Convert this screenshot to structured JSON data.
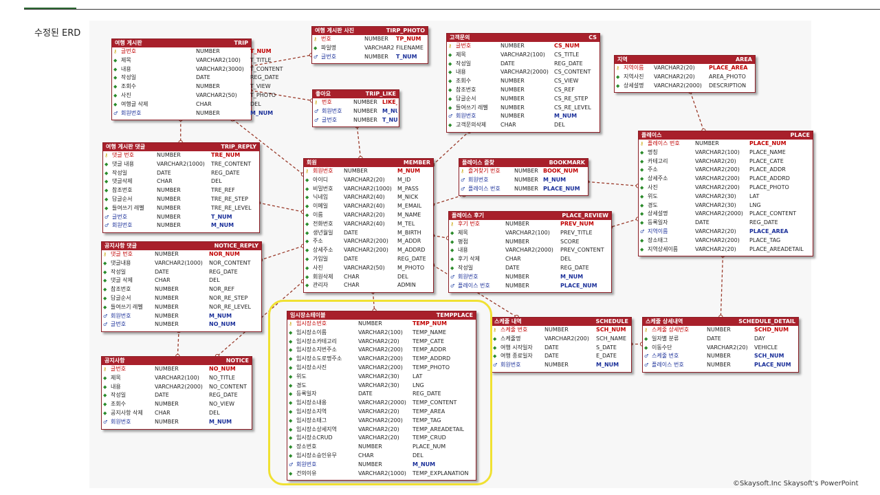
{
  "slide": {
    "title": "수정된 ERD",
    "watermark": "©Skaysoft.Inc Skaysoft's PowerPoint"
  },
  "colors": {
    "header": "#a8202b",
    "pk": "#c00000",
    "fk": "#1a2f99",
    "highlight": "#f0e132"
  },
  "entities": [
    {
      "id": "trip",
      "title": "여행 게시판",
      "table": "TRIP",
      "cols": [
        122,
        201
      ],
      "attributes": [
        {
          "name": "글번호",
          "type": "NUMBER",
          "column": "T_NUM",
          "key": "pk"
        },
        {
          "name": "제목",
          "type": "VARCHAR2(100)",
          "column": "T_TITLE",
          "key": "none"
        },
        {
          "name": "내용",
          "type": "VARCHAR2(3000)",
          "column": "T_CONTENT",
          "key": "none"
        },
        {
          "name": "작성일",
          "type": "DATE",
          "column": "REG_DATE",
          "key": "none"
        },
        {
          "name": "조회수",
          "type": "NUMBER",
          "column": "T_VIEW",
          "key": "none"
        },
        {
          "name": "사진",
          "type": "VARCHAR2(50)",
          "column": "T_PHOTO",
          "key": "none"
        },
        {
          "name": "여행글 삭제",
          "type": "CHAR",
          "column": "DEL",
          "key": "none"
        },
        {
          "name": "회원번호",
          "type": "NUMBER",
          "column": "M_NUM",
          "key": "fk"
        }
      ]
    },
    {
      "id": "trip_photo",
      "title": "여행 게시판 사진",
      "table": "TIRP_PHOTO",
      "cols": [
        76,
        122
      ],
      "attributes": [
        {
          "name": "번호",
          "type": "NUMBER",
          "column": "TP_NUM",
          "key": "pk"
        },
        {
          "name": "파일명",
          "type": "VARCHAR2(200)",
          "column": "FILENAME",
          "key": "none"
        },
        {
          "name": "글번호",
          "type": "NUMBER",
          "column": "T_NUM",
          "key": "fk"
        }
      ]
    },
    {
      "id": "trip_like",
      "title": "좋아요",
      "table": "TRIP_LIKE",
      "cols": [
        59,
        101
      ],
      "attributes": [
        {
          "name": "번호",
          "type": "NUMBER",
          "column": "LIKE_NUM",
          "key": "pk"
        },
        {
          "name": "회원번호",
          "type": "NUMBER",
          "column": "M_NUM",
          "key": "fk"
        },
        {
          "name": "글번호",
          "type": "NUMBER",
          "column": "T_NUM",
          "key": "fk"
        }
      ]
    },
    {
      "id": "cs",
      "title": "고객문의",
      "table": "CS",
      "cols": [
        78,
        156
      ],
      "attributes": [
        {
          "name": "글번호",
          "type": "NUMBER",
          "column": "CS_NUM",
          "key": "pk"
        },
        {
          "name": "제목",
          "type": "VARCHAR2(100)",
          "column": "CS_TITLE",
          "key": "none"
        },
        {
          "name": "작성일",
          "type": "DATE",
          "column": "REG_DATE",
          "key": "none"
        },
        {
          "name": "내용",
          "type": "VARCHAR2(2000)",
          "column": "CS_CONTENT",
          "key": "none"
        },
        {
          "name": "조회수",
          "type": "NUMBER",
          "column": "CS_VIEW",
          "key": "none"
        },
        {
          "name": "참조번호",
          "type": "NUMBER",
          "column": "CS_REF",
          "key": "none"
        },
        {
          "name": "답글순서",
          "type": "NUMBER",
          "column": "CS_RE_STEP",
          "key": "none"
        },
        {
          "name": "들여쓰기 레벨",
          "type": "NUMBER",
          "column": "CS_RE_LEVEL",
          "key": "none"
        },
        {
          "name": "회원번호",
          "type": "NUMBER",
          "column": "M_NUM",
          "key": "fk"
        },
        {
          "name": "고객문의삭제",
          "type": "CHAR",
          "column": "DEL",
          "key": "none"
        }
      ]
    },
    {
      "id": "area",
      "title": "지역",
      "table": "AREA",
      "cols": [
        57,
        137
      ],
      "attributes": [
        {
          "name": "지역이름",
          "type": "VARCHAR2(20)",
          "column": "PLACE_AREA",
          "key": "pk"
        },
        {
          "name": "지역사진",
          "type": "VARCHAR2(20)",
          "column": "AREA_PHOTO",
          "key": "none"
        },
        {
          "name": "상세설명",
          "type": "VARCHAR2(2000)",
          "column": "DESCRIPTION",
          "key": "none"
        }
      ]
    },
    {
      "id": "trip_reply",
      "title": "여행 게시판 댓글",
      "table": "TRIP_REPLY",
      "cols": [
        78,
        157
      ],
      "attributes": [
        {
          "name": "댓글 번호",
          "type": "NUMBER",
          "column": "TRE_NUM",
          "key": "pk"
        },
        {
          "name": "댓글 내용",
          "type": "VARCHAR2(1000)",
          "column": "TRE_CONTENT",
          "key": "none"
        },
        {
          "name": "작성일",
          "type": "DATE",
          "column": "REG_DATE",
          "key": "none"
        },
        {
          "name": "댓글삭제",
          "type": "CHAR",
          "column": "DEL",
          "key": "none"
        },
        {
          "name": "참조번호",
          "type": "NUMBER",
          "column": "TRE_REF",
          "key": "none"
        },
        {
          "name": "답글순서",
          "type": "NUMBER",
          "column": "TRE_RE_STEP",
          "key": "none"
        },
        {
          "name": "들여쓰기 레벨",
          "type": "NUMBER",
          "column": "TRE_RE_LEVEL",
          "key": "none"
        },
        {
          "name": "글번호",
          "type": "NUMBER",
          "column": "T_NUM",
          "key": "fk"
        },
        {
          "name": "회원번호",
          "type": "NUMBER",
          "column": "M_NUM",
          "key": "fk"
        }
      ]
    },
    {
      "id": "member",
      "title": "회원",
      "table": "MEMBER",
      "cols": [
        58,
        136
      ],
      "attributes": [
        {
          "name": "회원번호",
          "type": "NUMBER",
          "column": "M_NUM",
          "key": "pk"
        },
        {
          "name": "아이디",
          "type": "VARCHAR2(20)",
          "column": "M_ID",
          "key": "none"
        },
        {
          "name": "비밀번호",
          "type": "VARCHAR2(1000)",
          "column": "M_PASS",
          "key": "none"
        },
        {
          "name": "닉네임",
          "type": "VARCHAR2(40)",
          "column": "M_NICK",
          "key": "none"
        },
        {
          "name": "이메일",
          "type": "VARCHAR2(40)",
          "column": "M_EMAIL",
          "key": "none"
        },
        {
          "name": "이름",
          "type": "VARCHAR2(20)",
          "column": "M_NAME",
          "key": "none"
        },
        {
          "name": "전화번호",
          "type": "VARCHAR2(40)",
          "column": "M_TEL",
          "key": "none"
        },
        {
          "name": "생년월일",
          "type": "DATE",
          "column": "M_BIRTH",
          "key": "none"
        },
        {
          "name": "주소",
          "type": "VARCHAR2(200)",
          "column": "M_ADDR",
          "key": "none"
        },
        {
          "name": "상세주소",
          "type": "VARCHAR2(200)",
          "column": "M_ADDRD",
          "key": "none"
        },
        {
          "name": "가입일",
          "type": "DATE",
          "column": "REG_DATE",
          "key": "none"
        },
        {
          "name": "사진",
          "type": "VARCHAR2(50)",
          "column": "M_PHOTO",
          "key": "none"
        },
        {
          "name": "회원삭제",
          "type": "CHAR",
          "column": "DEL",
          "key": "none"
        },
        {
          "name": "관리자",
          "type": "CHAR",
          "column": "ADMIN",
          "key": "none"
        }
      ]
    },
    {
      "id": "bookmark",
      "title": "플레이스 즐찾",
      "table": "BOOKMARK",
      "cols": [
        80,
        122
      ],
      "attributes": [
        {
          "name": "즐겨찾기 번호",
          "type": "NUMBER",
          "column": "BOOK_NUM",
          "key": "pk"
        },
        {
          "name": "회원번호",
          "type": "NUMBER",
          "column": "M_NUM",
          "key": "fk"
        },
        {
          "name": "플레이스 번호",
          "type": "NUMBER",
          "column": "PLACE_NUM",
          "key": "fk"
        }
      ]
    },
    {
      "id": "place",
      "title": "플레이스",
      "table": "PLACE",
      "cols": [
        82,
        161
      ],
      "attributes": [
        {
          "name": "플레이스 번호",
          "type": "NUMBER",
          "column": "PLACE_NUM",
          "key": "pk"
        },
        {
          "name": "명칭",
          "type": "VARCHAR2(100)",
          "column": "PLACE_NAME",
          "key": "none"
        },
        {
          "name": "카테고리",
          "type": "VARCHAR2(20)",
          "column": "PLACE_CATE",
          "key": "none"
        },
        {
          "name": "주소",
          "type": "VARCHAR2(200)",
          "column": "PLACE_ADDR",
          "key": "none"
        },
        {
          "name": "상세주소",
          "type": "VARCHAR2(200)",
          "column": "PLACE_ADDRD",
          "key": "none"
        },
        {
          "name": "사진",
          "type": "VARCHAR2(200)",
          "column": "PLACE_PHOTO",
          "key": "none"
        },
        {
          "name": "위도",
          "type": "VARCHAR2(30)",
          "column": "LAT",
          "key": "none"
        },
        {
          "name": "경도",
          "type": "VARCHAR2(30)",
          "column": "LNG",
          "key": "none"
        },
        {
          "name": "상세설명",
          "type": "VARCHAR2(2000)",
          "column": "PLACE_CONTENT",
          "key": "none"
        },
        {
          "name": "등록일자",
          "type": "DATE",
          "column": "REG_DATE",
          "key": "none"
        },
        {
          "name": "지역이름",
          "type": "VARCHAR2(20)",
          "column": "PLACE_AREA",
          "key": "fk"
        },
        {
          "name": "장소태그",
          "type": "VARCHAR2(200)",
          "column": "PLACE_TAG",
          "key": "none"
        },
        {
          "name": "지역상세이름",
          "type": "VARCHAR2(20)",
          "column": "PLACE_AREADETAIL",
          "key": "none"
        }
      ]
    },
    {
      "id": "notice_reply",
      "title": "공지사항 댓글",
      "table": "NOTICE_REPLY",
      "cols": [
        77,
        156
      ],
      "attributes": [
        {
          "name": "댓글 번호",
          "type": "NUMBER",
          "column": "NOR_NUM",
          "key": "pk"
        },
        {
          "name": "댓글내용",
          "type": "VARCHAR2(1000)",
          "column": "NOR_CONTENT",
          "key": "none"
        },
        {
          "name": "작성일",
          "type": "DATE",
          "column": "REG_DATE",
          "key": "none"
        },
        {
          "name": "댓글 삭제",
          "type": "CHAR",
          "column": "DEL",
          "key": "none"
        },
        {
          "name": "참조번호",
          "type": "NUMBER",
          "column": "NOR_REF",
          "key": "none"
        },
        {
          "name": "답글순서",
          "type": "NUMBER",
          "column": "NOR_RE_STEP",
          "key": "none"
        },
        {
          "name": "들여쓰기 레벨",
          "type": "NUMBER",
          "column": "NOR_RE_LEVEL",
          "key": "none"
        },
        {
          "name": "회원번호",
          "type": "NUMBER",
          "column": "M_NUM",
          "key": "fk"
        },
        {
          "name": "글번호",
          "type": "NUMBER",
          "column": "NO_NUM",
          "key": "fk"
        }
      ]
    },
    {
      "id": "place_review",
      "title": "플레이스 후기",
      "table": "PLACE_REVIEW",
      "cols": [
        82,
        162
      ],
      "attributes": [
        {
          "name": "후기 번호",
          "type": "NUMBER",
          "column": "PREV_NUM",
          "key": "pk"
        },
        {
          "name": "제목",
          "type": "VARCHAR2(100)",
          "column": "PREV_TITLE",
          "key": "none"
        },
        {
          "name": "평점",
          "type": "NUMBER",
          "column": "SCORE",
          "key": "none"
        },
        {
          "name": "내용",
          "type": "VARCHAR2(2000)",
          "column": "PREV_CONTENT",
          "key": "none"
        },
        {
          "name": "후기 삭제",
          "type": "CHAR",
          "column": "DEL",
          "key": "none"
        },
        {
          "name": "작성일",
          "type": "DATE",
          "column": "REG_DATE",
          "key": "none"
        },
        {
          "name": "회원번호",
          "type": "NUMBER",
          "column": "M_NUM",
          "key": "fk"
        },
        {
          "name": "플레이스 번호",
          "type": "NUMBER",
          "column": "PLACE_NUM",
          "key": "fk"
        }
      ]
    },
    {
      "id": "tempplace",
      "title": "임시장소테이블",
      "table": "TEMPPLACE",
      "cols": [
        103,
        182
      ],
      "attributes": [
        {
          "name": "임시장소번호",
          "type": "NUMBER",
          "column": "TEMP_NUM",
          "key": "pk"
        },
        {
          "name": "임시장소이름",
          "type": "VARCHAR2(100)",
          "column": "TEMP_NAME",
          "key": "none"
        },
        {
          "name": "임시장소카테고리",
          "type": "VARCHAR2(20)",
          "column": "TEMP_CATE",
          "key": "none"
        },
        {
          "name": "임시장소지번주소",
          "type": "VARCHAR2(200)",
          "column": "TEMP_ADDR",
          "key": "none"
        },
        {
          "name": "임시장소도로명주소",
          "type": "VARCHAR2(200)",
          "column": "TEMP_ADDRD",
          "key": "none"
        },
        {
          "name": "임시장소사진",
          "type": "VARCHAR2(200)",
          "column": "TEMP_PHOTO",
          "key": "none"
        },
        {
          "name": "위도",
          "type": "VARCHAR2(30)",
          "column": "LAT",
          "key": "none"
        },
        {
          "name": "경도",
          "type": "VARCHAR2(30)",
          "column": "LNG",
          "key": "none"
        },
        {
          "name": "등록일자",
          "type": "DATE",
          "column": "REG_DATE",
          "key": "none"
        },
        {
          "name": "임시장소내용",
          "type": "VARCHAR2(2000)",
          "column": "TEMP_CONTENT",
          "key": "none"
        },
        {
          "name": "임시장소지역",
          "type": "VARCHAR2(20)",
          "column": "TEMP_AREA",
          "key": "none"
        },
        {
          "name": "임시장소태그",
          "type": "VARCHAR2(200)",
          "column": "TEMP_TAG",
          "key": "none"
        },
        {
          "name": "임시장소상세지역",
          "type": "VARCHAR2(20)",
          "column": "TEMP_AREADETAIL",
          "key": "none"
        },
        {
          "name": "임시장소CRUD",
          "type": "VARCHAR2(20)",
          "column": "TEMP_CRUD",
          "key": "none"
        },
        {
          "name": "장소번호",
          "type": "NUMBER",
          "column": "PLACE_NUM",
          "key": "none"
        },
        {
          "name": "임시장소승인유무",
          "type": "CHAR",
          "column": "DEL",
          "key": "none"
        },
        {
          "name": "회원번호",
          "type": "NUMBER",
          "column": "M_NUM",
          "key": "fk"
        },
        {
          "name": "건의이유",
          "type": "VARCHAR2(1000)",
          "column": "TEMP_EXPLANATION",
          "key": "none"
        }
      ]
    },
    {
      "id": "schedule",
      "title": "스케줄 내역",
      "table": "SCHEDULE",
      "cols": [
        77,
        152
      ],
      "attributes": [
        {
          "name": "스케줄 번호",
          "type": "NUMBER",
          "column": "SCH_NUM",
          "key": "pk"
        },
        {
          "name": "스케줄명",
          "type": "VARCHAR2(200)",
          "column": "SCH_NAME",
          "key": "none"
        },
        {
          "name": "여행 시작일자",
          "type": "DATE",
          "column": "S_DATE",
          "key": "none"
        },
        {
          "name": "여행 종료일자",
          "type": "DATE",
          "column": "E_DATE",
          "key": "none"
        },
        {
          "name": "회원번호",
          "type": "NUMBER",
          "column": "M_NUM",
          "key": "fk"
        }
      ]
    },
    {
      "id": "schedule_detail",
      "title": "스케줄 상세내역",
      "table": "SCHEDULE_DETAIL",
      "cols": [
        93,
        162
      ],
      "attributes": [
        {
          "name": "스케줄 상세번호",
          "type": "NUMBER",
          "column": "SCHD_NUM",
          "key": "pk"
        },
        {
          "name": "일자별 분류",
          "type": "DATE",
          "column": "DAY",
          "key": "none"
        },
        {
          "name": "이동수단",
          "type": "VARCHAR2(20)",
          "column": "VEHICLE",
          "key": "none"
        },
        {
          "name": "스케줄 번호",
          "type": "NUMBER",
          "column": "SCH_NUM",
          "key": "fk"
        },
        {
          "name": "플레이스 번호",
          "type": "NUMBER",
          "column": "PLACE_NUM",
          "key": "fk"
        }
      ]
    },
    {
      "id": "notice",
      "title": "공지사항",
      "table": "NOTICE",
      "cols": [
        77,
        156
      ],
      "attributes": [
        {
          "name": "글번호",
          "type": "NUMBER",
          "column": "NO_NUM",
          "key": "pk"
        },
        {
          "name": "제목",
          "type": "VARCHAR2(100)",
          "column": "NO_TITLE",
          "key": "none"
        },
        {
          "name": "내용",
          "type": "VARCHAR2(2000)",
          "column": "NO_CONTENT",
          "key": "none"
        },
        {
          "name": "작성일",
          "type": "DATE",
          "column": "REG_DATE",
          "key": "none"
        },
        {
          "name": "조회수",
          "type": "NUMBER",
          "column": "NO_VIEW",
          "key": "none"
        },
        {
          "name": "공지사항 삭제",
          "type": "CHAR",
          "column": "DEL",
          "key": "none"
        },
        {
          "name": "회원번호",
          "type": "NUMBER",
          "column": "M_NUM",
          "key": "fk"
        }
      ]
    }
  ],
  "relationships": [
    {
      "from": "trip",
      "to": "trip_photo"
    },
    {
      "from": "trip",
      "to": "trip_like"
    },
    {
      "from": "trip",
      "to": "trip_reply"
    },
    {
      "from": "trip",
      "to": "member"
    },
    {
      "from": "member",
      "to": "trip_like"
    },
    {
      "from": "member",
      "to": "cs"
    },
    {
      "from": "member",
      "to": "trip_reply"
    },
    {
      "from": "member",
      "to": "bookmark"
    },
    {
      "from": "member",
      "to": "notice_reply"
    },
    {
      "from": "member",
      "to": "place_review"
    },
    {
      "from": "member",
      "to": "tempplace"
    },
    {
      "from": "member",
      "to": "schedule"
    },
    {
      "from": "member",
      "to": "notice"
    },
    {
      "from": "area",
      "to": "place"
    },
    {
      "from": "place",
      "to": "bookmark"
    },
    {
      "from": "place",
      "to": "place_review"
    },
    {
      "from": "place",
      "to": "schedule_detail"
    },
    {
      "from": "schedule",
      "to": "schedule_detail"
    },
    {
      "from": "notice",
      "to": "notice_reply"
    }
  ]
}
